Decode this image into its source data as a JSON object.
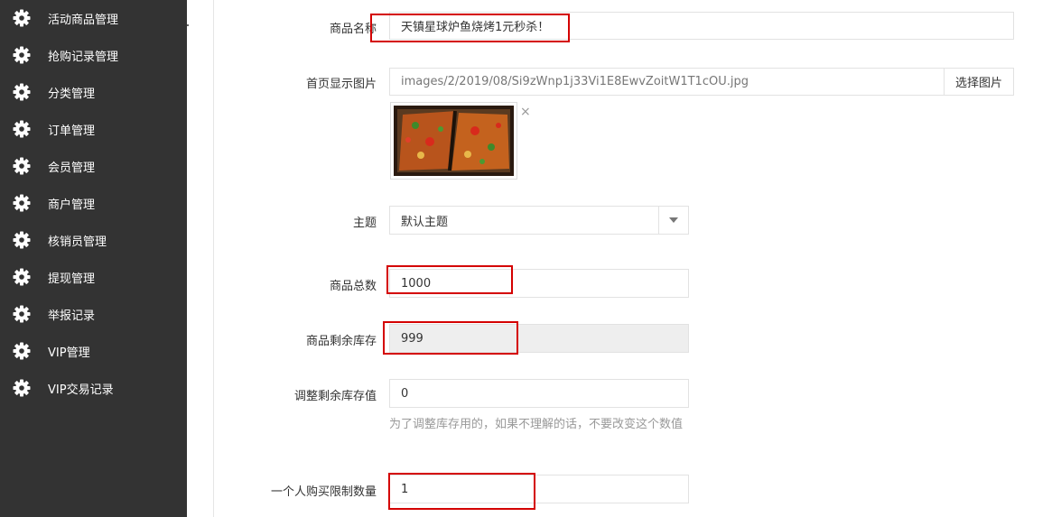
{
  "sidebar": {
    "items": [
      {
        "label": "活动商品管理"
      },
      {
        "label": "抢购记录管理"
      },
      {
        "label": "分类管理"
      },
      {
        "label": "订单管理"
      },
      {
        "label": "会员管理"
      },
      {
        "label": "商户管理"
      },
      {
        "label": "核销员管理"
      },
      {
        "label": "提现管理"
      },
      {
        "label": "举报记录"
      },
      {
        "label": "VIP管理"
      },
      {
        "label": "VIP交易记录"
      }
    ],
    "icon": "gear-icon"
  },
  "form": {
    "name": {
      "label": "商品名称",
      "value": "天镇星球炉鱼烧烤1元秒杀！"
    },
    "image": {
      "label": "首页显示图片",
      "value": "images/2/2019/08/Si9zWnp1j33Vi1E8EwvZoitW1T1cOU.jpg",
      "button": "选择图片",
      "remove": "×"
    },
    "theme": {
      "label": "主题",
      "value": "默认主题"
    },
    "total": {
      "label": "商品总数",
      "value": "1000"
    },
    "remaining": {
      "label": "商品剩余库存",
      "value": "999"
    },
    "adjust": {
      "label": "调整剩余库存值",
      "value": "0",
      "hint": "为了调整库存用的，如果不理解的话，不要改变这个数值"
    },
    "limit": {
      "label": "一个人购买限制数量",
      "value": "1"
    }
  },
  "colors": {
    "sidebar_bg": "#333333",
    "highlight": "#d40000"
  }
}
